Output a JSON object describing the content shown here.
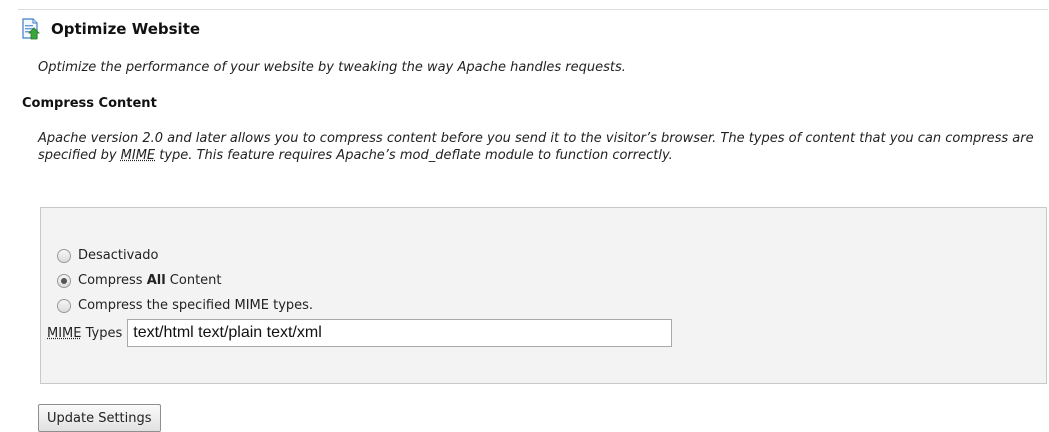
{
  "header": {
    "title": "Optimize Website",
    "icon": "page-optimize-icon"
  },
  "intro": "Optimize the performance of your website by tweaking the way Apache handles requests.",
  "section": {
    "title": "Compress Content",
    "description_part1": "Apache version 2.0 and later allows you to compress content before you send it to the visitor’s browser. The types of content that you can compress are specified by ",
    "description_abbr": "MIME",
    "description_part2": " type. This feature requires Apache’s mod_deflate module to function correctly."
  },
  "options": {
    "disabled_label": "Desactivado",
    "compress_all_prefix": "Compress ",
    "compress_all_bold": "All",
    "compress_all_suffix": " Content",
    "compress_specified_label": "Compress the specified MIME types.",
    "selected": "compress_all"
  },
  "mime": {
    "label_abbr": "MIME",
    "label_rest": " Types",
    "value": "text/html text/plain text/xml"
  },
  "button": {
    "label": "Update Settings"
  }
}
